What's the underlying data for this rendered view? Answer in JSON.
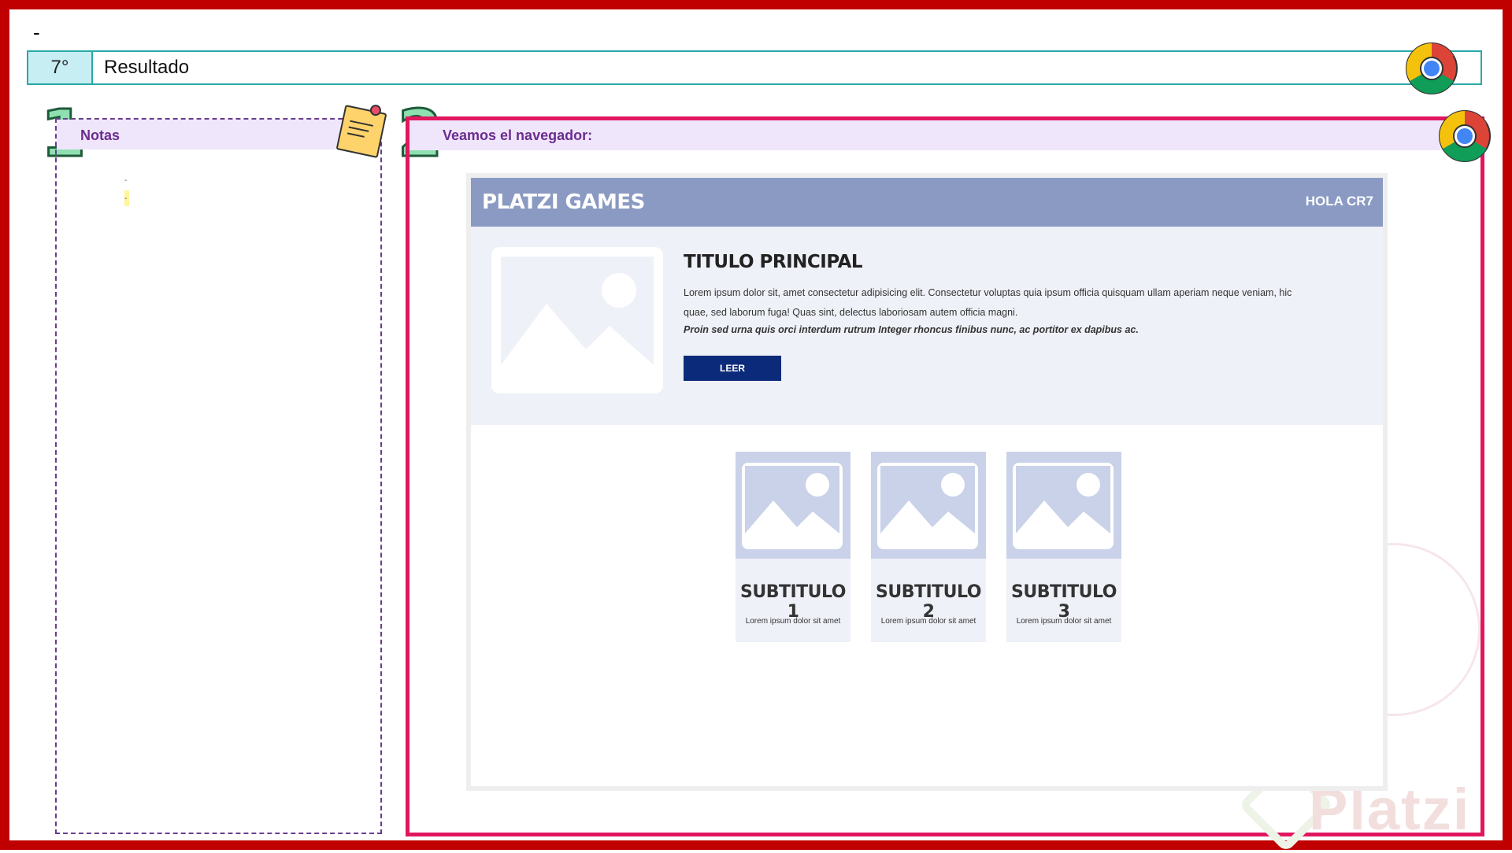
{
  "top_marker": "-",
  "step": {
    "number": "7°",
    "title": "Resultado"
  },
  "notes": {
    "index": "1",
    "label": "Notas",
    "line_dash": "-",
    "line_mark": "-"
  },
  "browser": {
    "index": "2",
    "label": "Veamos el navegador:"
  },
  "site": {
    "brand": "PLATZI GAMES",
    "greeting": "HOLA CR7",
    "hero": {
      "title": "TITULO PRINCIPAL",
      "text": "Lorem ipsum dolor sit, amet consectetur adipisicing elit. Consectetur voluptas quia ipsum officia quisquam ullam aperiam neque veniam, hic quae, sed laborum fuga! Quas sint, delectus laboriosam autem officia magni.",
      "emphasis": "Proin sed urna quis orci interdum rutrum Integer rhoncus finibus nunc, ac portitor ex dapibus ac.",
      "button_label": "LEER"
    },
    "cards": [
      {
        "title": "SUBTITULO 1",
        "text": "Lorem ipsum dolor sit amet"
      },
      {
        "title": "SUBTITULO 2",
        "text": "Lorem ipsum dolor sit amet"
      },
      {
        "title": "SUBTITULO 3",
        "text": "Lorem ipsum dolor sit amet"
      }
    ]
  },
  "watermark": "Platzi",
  "icons": {
    "chrome": "chrome-icon",
    "sticky_note": "sticky-note-icon",
    "image_placeholder": "image-placeholder-icon"
  },
  "colors": {
    "frame": "#c00000",
    "step_border": "#2aa8a8",
    "browser_border": "#e0175e",
    "site_header": "#8a9ac2",
    "button": "#0b2a7a"
  }
}
